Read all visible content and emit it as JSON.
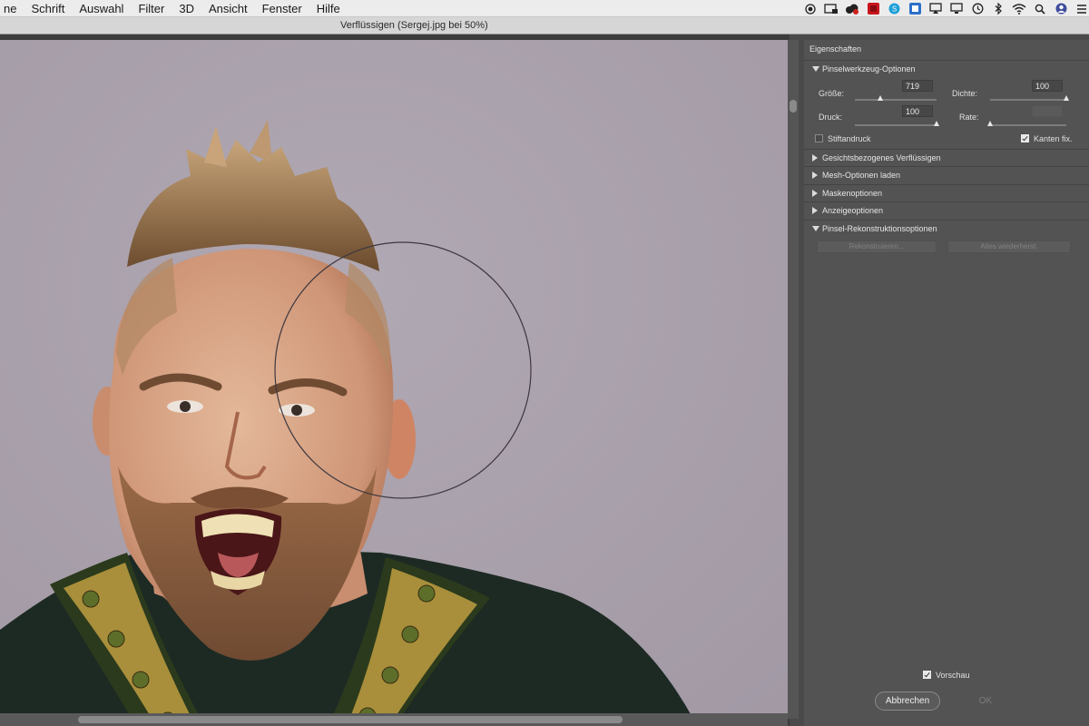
{
  "menubar": {
    "items": [
      {
        "label": "ne"
      },
      {
        "label": "Schrift"
      },
      {
        "label": "Auswahl"
      },
      {
        "label": "Filter"
      },
      {
        "label": "3D"
      },
      {
        "label": "Ansicht"
      },
      {
        "label": "Fenster"
      },
      {
        "label": "Hilfe"
      }
    ],
    "status_icons": [
      "record-icon",
      "screen-capture-icon",
      "cloud-icon",
      "app-icon",
      "skype-icon",
      "dropbox-icon",
      "airplay-icon",
      "display-icon",
      "time-machine-icon",
      "bluetooth-icon",
      "wifi-icon",
      "search-icon",
      "user-icon",
      "list-icon"
    ]
  },
  "dialog": {
    "title": "Verflüssigen (Sergej.jpg bei 50%)"
  },
  "panel": {
    "title": "Eigenschaften",
    "brush_section": {
      "label": "Pinselwerkzeug-Optionen",
      "size": {
        "label": "Größe:",
        "value": "719",
        "fraction": 0.31
      },
      "density": {
        "label": "Dichte:",
        "value": "100",
        "fraction": 1.0
      },
      "pressure": {
        "label": "Druck:",
        "value": "100",
        "fraction": 1.0
      },
      "rate": {
        "label": "Rate:",
        "value": "",
        "fraction": 0.0
      },
      "stylus_pressure": {
        "label": "Stiftandruck",
        "checked": false
      },
      "pin_edges": {
        "label": "Kanten fix.",
        "checked": true
      }
    },
    "sections": [
      {
        "label": "Gesichtsbezogenes Verflüssigen",
        "expanded": false
      },
      {
        "label": "Mesh-Optionen laden",
        "expanded": false
      },
      {
        "label": "Maskenoptionen",
        "expanded": false
      },
      {
        "label": "Anzeigeoptionen",
        "expanded": false
      },
      {
        "label": "Pinsel-Rekonstruktionsoptionen",
        "expanded": true
      }
    ],
    "reconstruct": {
      "reconstruct_label": "Rekonstruieren...",
      "restore_all_label": "Alles wiederherst."
    },
    "preview": {
      "label": "Vorschau",
      "checked": true
    },
    "cancel_label": "Abbrechen",
    "ok_label": "OK"
  },
  "colors": {
    "panel_bg": "#535353",
    "canvas_bg": "#a9a1aa",
    "menubar_bg": "#ececec"
  }
}
